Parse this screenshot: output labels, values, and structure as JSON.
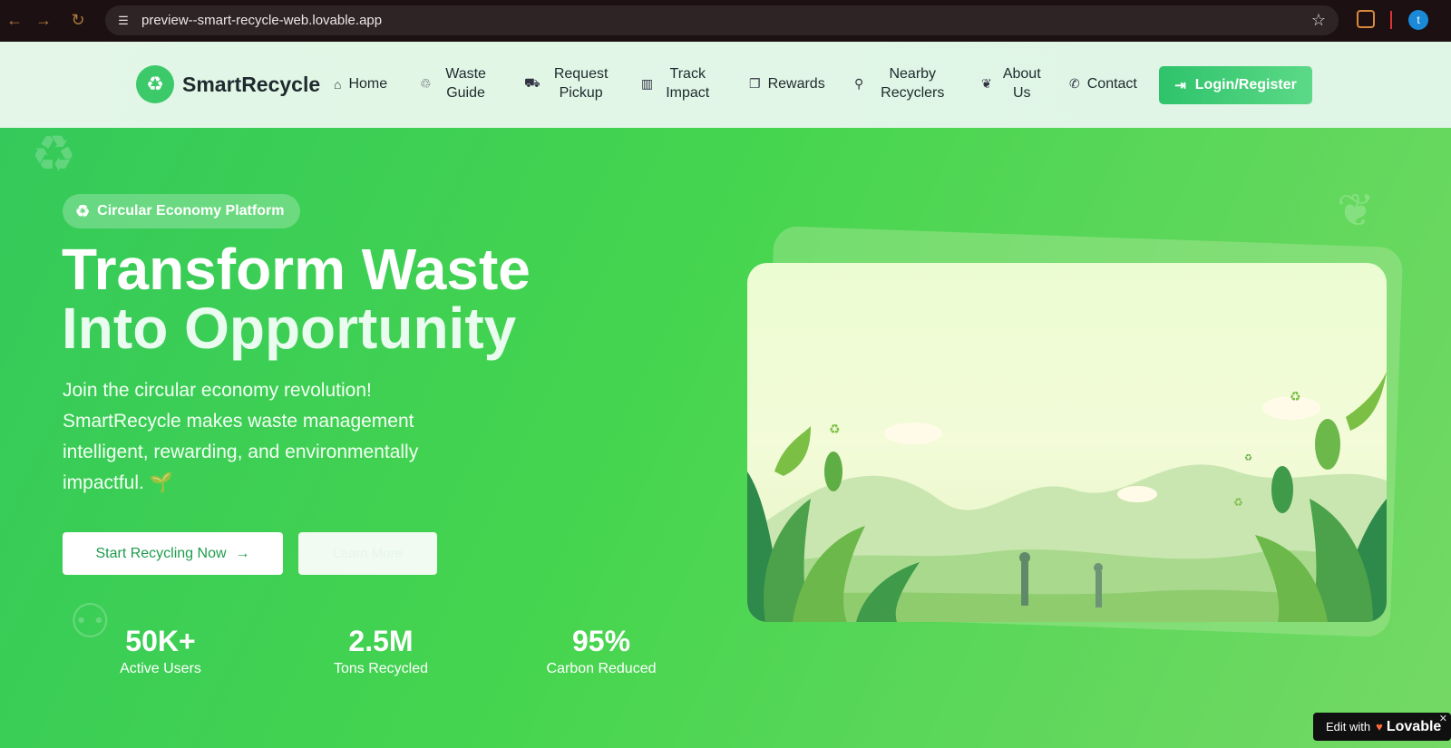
{
  "browser": {
    "url": "preview--smart-recycle-web.lovable.app",
    "profile_initial": "t"
  },
  "header": {
    "brand": "SmartRecycle",
    "nav": [
      {
        "label": "Home",
        "icon": "home-icon"
      },
      {
        "label": "Waste Guide",
        "icon": "recycle-icon"
      },
      {
        "label": "Request Pickup",
        "icon": "truck-icon"
      },
      {
        "label": "Track Impact",
        "icon": "bar-chart-icon"
      },
      {
        "label": "Rewards",
        "icon": "gift-icon"
      },
      {
        "label": "Nearby Recyclers",
        "icon": "map-pin-icon"
      },
      {
        "label": "About Us",
        "icon": "leaf-icon"
      },
      {
        "label": "Contact",
        "icon": "phone-icon"
      }
    ],
    "login_label": "Login/Register"
  },
  "hero": {
    "pill": "Circular Economy Platform",
    "headline_line1": "Transform Waste",
    "headline_line2": "Into Opportunity",
    "subtext": "Join the circular economy revolution! SmartRecycle makes waste management intelligent, rewarding, and environmentally impactful. 🌱",
    "primary_cta": "Start Recycling Now",
    "secondary_cta": "Learn More",
    "stats": [
      {
        "value": "50K+",
        "label": "Active Users"
      },
      {
        "value": "2.5M",
        "label": "Tons Recycled"
      },
      {
        "value": "95%",
        "label": "Carbon Reduced"
      }
    ]
  },
  "badge": {
    "prefix": "Edit with",
    "brand": "Lovable"
  },
  "colors": {
    "brand_green": "#3cc969",
    "hero_green": "#42d15a",
    "text_dark": "#1e2a2e"
  }
}
